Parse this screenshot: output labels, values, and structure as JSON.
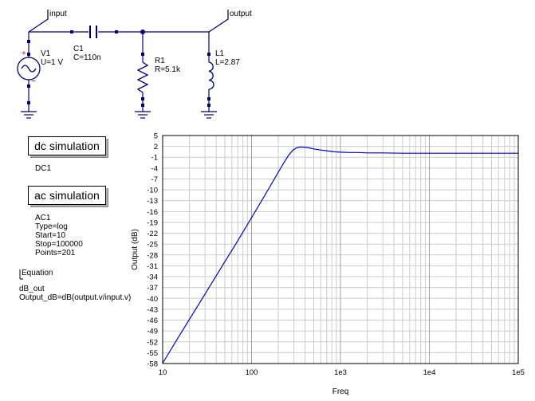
{
  "schematic": {
    "ports": {
      "input": "input",
      "output": "output"
    },
    "components": {
      "v1": {
        "name": "V1",
        "param": "U=1 V",
        "plus": "+",
        "minus": "−"
      },
      "c1": {
        "name": "C1",
        "param": "C=110n"
      },
      "r1": {
        "name": "R1",
        "param": "R=5.1k"
      },
      "l1": {
        "name": "L1",
        "param": "L=2.87"
      }
    },
    "wire_color": "#00007f",
    "component_color": "#00007f",
    "source_plus_color": "#ff0000"
  },
  "simulations": {
    "dc": {
      "label": "dc simulation",
      "name": "DC1"
    },
    "ac": {
      "label": "ac simulation",
      "name": "AC1",
      "params": [
        "Type=log",
        "Start=10",
        "Stop=100000",
        "Points=201"
      ]
    }
  },
  "equation": {
    "label": "Equation",
    "name": "dB_out",
    "expr": "Output_dB=dB(output.v/input.v)"
  },
  "chart_data": {
    "type": "line",
    "xlabel": "Freq",
    "ylabel": "Output (dB)",
    "x_scale": "log",
    "xlim": [
      10,
      100000
    ],
    "ylim": [
      -58,
      5
    ],
    "x_ticks": [
      "10",
      "100",
      "1e3",
      "1e4",
      "1e5"
    ],
    "y_ticks": [
      "5",
      "2",
      "-1",
      "-4",
      "-7",
      "-10",
      "-13",
      "-16",
      "-19",
      "-22",
      "-25",
      "-28",
      "-31",
      "-34",
      "-37",
      "-40",
      "-43",
      "-46",
      "-49",
      "-52",
      "-55",
      "-58"
    ],
    "grid": true,
    "line_color": "#0000cc",
    "series": [
      {
        "x": [
          10,
          15,
          20,
          30,
          40,
          50,
          70,
          100,
          130,
          160,
          200,
          230,
          260,
          290,
          320,
          350,
          380,
          420,
          460,
          500,
          600,
          700,
          850,
          1000,
          1300,
          1600,
          2000,
          3000,
          5000,
          10000,
          20000,
          50000,
          100000
        ],
        "y": [
          -57.9,
          -50.8,
          -45.8,
          -38.8,
          -33.8,
          -29.9,
          -24.1,
          -17.7,
          -13.0,
          -9.2,
          -5.1,
          -2.6,
          -0.5,
          0.9,
          1.6,
          1.8,
          1.8,
          1.7,
          1.5,
          1.3,
          1.0,
          0.8,
          0.5,
          0.4,
          0.3,
          0.3,
          0.2,
          0.2,
          0.1,
          0.1,
          0.1,
          0.1,
          0.1
        ]
      }
    ]
  }
}
